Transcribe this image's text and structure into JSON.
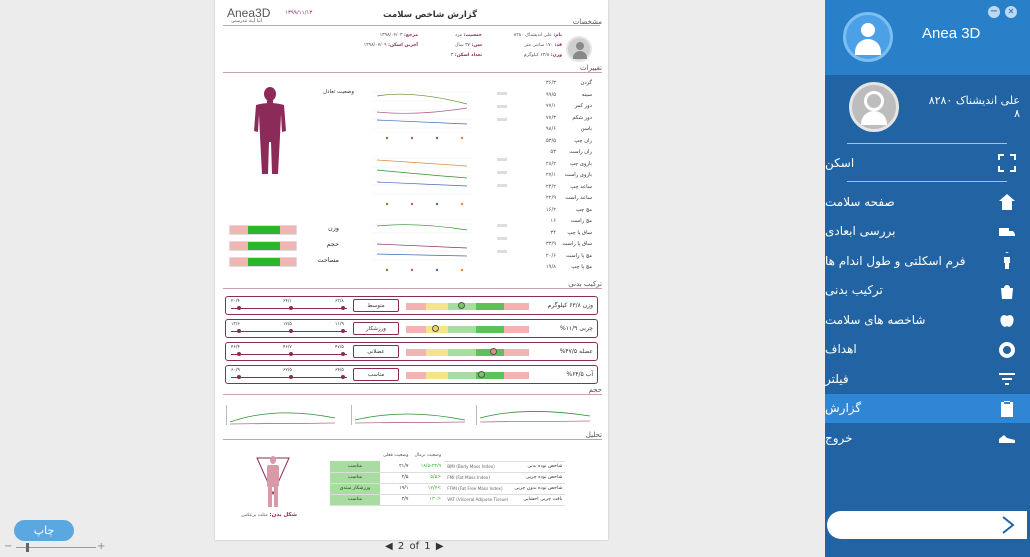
{
  "header": {
    "title": "گزارش شاخص سلامت",
    "date": "۱۳۹۹/۱۱/۱۳",
    "logo": "Anea3D",
    "logo_sub": "آنیا آینه تندرستی"
  },
  "profile": {
    "section": "مشخصات",
    "name_label": "نام:",
    "name": "علی اندیشناک ۸۲۸۰",
    "gender_label": "جنسیت:",
    "gender": "مرد",
    "ref_label": "مرجع:",
    "ref": "۱۳۹۸/۰۴/۰۳",
    "height_label": "قد:",
    "height": "۱۷۰ سانتی متر",
    "age_label": "سن:",
    "age": "۳۷ سال",
    "last_label": "آخرین اسکن:",
    "last": "۱۳۹۸/۰۷/۰۹",
    "weight_label": "وزن:",
    "weight": "۶۳/۸ کیلوگرم",
    "count_label": "تعداد اسکن:",
    "count": "۳"
  },
  "changes": {
    "section": "تغییرات",
    "balance_label": "وضعیت تعادل",
    "rows": [
      {
        "name": "گردن",
        "value": "۳۶/۳"
      },
      {
        "name": "سینه",
        "value": "۹۹/۵"
      },
      {
        "name": "دور کمر",
        "value": "۷۷/۱"
      },
      {
        "name": "دور شکم",
        "value": "۷۷/۳"
      },
      {
        "name": "باسن",
        "value": "۹۸/۶"
      },
      {
        "name": "ران چپ",
        "value": "۵۳/۵"
      },
      {
        "name": "ران راست",
        "value": "۵۳"
      },
      {
        "name": "بازوی چپ",
        "value": "۲۸/۲"
      },
      {
        "name": "بازوی راست",
        "value": "۲۷/۱"
      },
      {
        "name": "ساعد چپ",
        "value": "۲۴/۲"
      },
      {
        "name": "ساعد راست",
        "value": "۲۲/۹"
      },
      {
        "name": "مچ چپ",
        "value": "۱۶/۲"
      },
      {
        "name": "مچ راست",
        "value": "۱۶"
      },
      {
        "name": "ساق پا چپ",
        "value": "۳۴"
      },
      {
        "name": "ساق پا راست",
        "value": "۳۳/۹"
      },
      {
        "name": "مچ پا راست",
        "value": "۲۰/۶"
      },
      {
        "name": "مچ پا چپ",
        "value": "۱۹/۸"
      }
    ],
    "bars": [
      {
        "label": "وزن"
      },
      {
        "label": "حجم"
      },
      {
        "label": "مساحت"
      }
    ]
  },
  "composition": {
    "section": "ترکیب بدنی",
    "rows": [
      {
        "label": "وزن ۶۳/۸ کیلوگرم",
        "status": "متوسط",
        "marker": 0.45,
        "marker_color": "#7cc36a",
        "history": [
          "۲۰/۴",
          "۶۴/۱",
          "۶۳/۸"
        ]
      },
      {
        "label": "چربی ۱۱/۹%",
        "status": "ورزشکار",
        "marker": 0.22,
        "marker_color": "#f2d35a",
        "history": [
          "۱۳/۶",
          "۱۲/۵",
          "۱۱/۹"
        ]
      },
      {
        "label": "عضله ۴۷/۵%",
        "status": "عضلانی",
        "marker": 0.72,
        "marker_color": "#e88a8a",
        "history": [
          "۴۶/۴",
          "۴۶/۷",
          "۴۷/۵"
        ]
      },
      {
        "label": "آب ۶۴/۵%",
        "status": "مناسب",
        "marker": 0.62,
        "marker_color": "#7cc36a",
        "history": [
          "۶۰/۹",
          "۶۲/۵",
          "۶۴/۵"
        ]
      }
    ]
  },
  "volume": {
    "section": "حجم"
  },
  "analysis": {
    "section": "تحلیل",
    "shape_label": "شکل بدن:",
    "shape": "مثلث برعکس",
    "col_normal": "وضعیت نرمال",
    "col_current": "وضعیت فعلی",
    "rows": [
      {
        "name": "شاخص توده بدنی",
        "abbr": "BMI (Body Mass Index)",
        "normal": "۱۸/۵-۲۴/۹",
        "current": "۲۱/۷",
        "status": "مناسب"
      },
      {
        "name": "شاخص توده چربی",
        "abbr": "FMI (Fat Mass Index)",
        "normal": "<۵/۵",
        "current": "۲/۵",
        "status": "مناسب"
      },
      {
        "name": "شاخص توده بدون چربی",
        "abbr": "FFMI (Fat Free Mass Index)",
        "normal": ">۱۷/۷",
        "current": "۱۹/۱",
        "status": "ورزشکار مبتدی"
      },
      {
        "name": "بافت چربی احشایی",
        "abbr": "VAT (Visceral Adipose Tissue)",
        "normal": "<۱۳۰",
        "current": "۳/۷",
        "status": "مناسب"
      }
    ]
  },
  "pager": {
    "current": "2",
    "of": "of",
    "total": "1"
  },
  "sidebar": {
    "app_title": "Anea 3D",
    "user_name": "علی اندیشناک ۸۲۸۰",
    "user_id": "۸",
    "scan_label": "اسکن",
    "items": [
      {
        "label": "صفحه سلامت",
        "icon": "home-icon"
      },
      {
        "label": "بررسی ابعادی",
        "icon": "truck-icon"
      },
      {
        "label": "فرم اسکلتی و طول اندام ها",
        "icon": "body-icon"
      },
      {
        "label": "ترکیب بدنی",
        "icon": "bag-icon"
      },
      {
        "label": "شاخصه های سلامت",
        "icon": "apple-icon"
      },
      {
        "label": "اهداف",
        "icon": "target-icon"
      },
      {
        "label": "فیلتر",
        "icon": "filter-icon"
      },
      {
        "label": "گزارش",
        "icon": "report-icon"
      },
      {
        "label": "خروج",
        "icon": "shoe-icon"
      }
    ],
    "active_index": 7
  },
  "print_button": "چاپ",
  "colors": {
    "brand": "#8c2b5a",
    "panel": "#2264a3",
    "panel_head": "#2a7fc9",
    "active": "#2e86d4",
    "green": "#2db52d",
    "pink": "#f2b3b3"
  }
}
